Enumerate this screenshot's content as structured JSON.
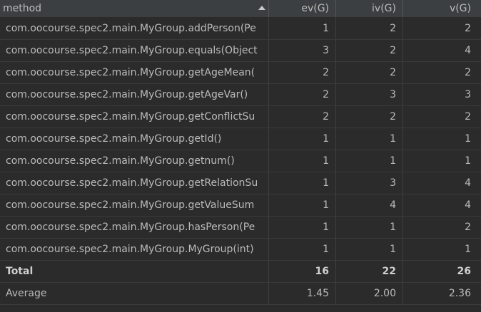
{
  "header": {
    "method": "method",
    "ev": "ev(G)",
    "iv": "iv(G)",
    "v": "v(G)"
  },
  "rows": [
    {
      "method": "com.oocourse.spec2.main.MyGroup.addPerson(Pe",
      "ev": "1",
      "iv": "2",
      "v": "2"
    },
    {
      "method": "com.oocourse.spec2.main.MyGroup.equals(Object",
      "ev": "3",
      "iv": "2",
      "v": "4"
    },
    {
      "method": "com.oocourse.spec2.main.MyGroup.getAgeMean(",
      "ev": "2",
      "iv": "2",
      "v": "2"
    },
    {
      "method": "com.oocourse.spec2.main.MyGroup.getAgeVar()",
      "ev": "2",
      "iv": "3",
      "v": "3"
    },
    {
      "method": "com.oocourse.spec2.main.MyGroup.getConflictSu",
      "ev": "2",
      "iv": "2",
      "v": "2"
    },
    {
      "method": "com.oocourse.spec2.main.MyGroup.getId()",
      "ev": "1",
      "iv": "1",
      "v": "1"
    },
    {
      "method": "com.oocourse.spec2.main.MyGroup.getnum()",
      "ev": "1",
      "iv": "1",
      "v": "1"
    },
    {
      "method": "com.oocourse.spec2.main.MyGroup.getRelationSu",
      "ev": "1",
      "iv": "3",
      "v": "4"
    },
    {
      "method": "com.oocourse.spec2.main.MyGroup.getValueSum",
      "ev": "1",
      "iv": "4",
      "v": "4"
    },
    {
      "method": "com.oocourse.spec2.main.MyGroup.hasPerson(Pe",
      "ev": "1",
      "iv": "1",
      "v": "2"
    },
    {
      "method": "com.oocourse.spec2.main.MyGroup.MyGroup(int)",
      "ev": "1",
      "iv": "1",
      "v": "1"
    }
  ],
  "total": {
    "label": "Total",
    "ev": "16",
    "iv": "22",
    "v": "26"
  },
  "average": {
    "label": "Average",
    "ev": "1.45",
    "iv": "2.00",
    "v": "2.36"
  },
  "colors": {
    "background": "#2b2b2b",
    "header_background": "#3c3f41",
    "text": "#bbbbbb",
    "grid": "#3a3a3a"
  },
  "icons": {
    "sort": "sort-ascending-icon"
  }
}
